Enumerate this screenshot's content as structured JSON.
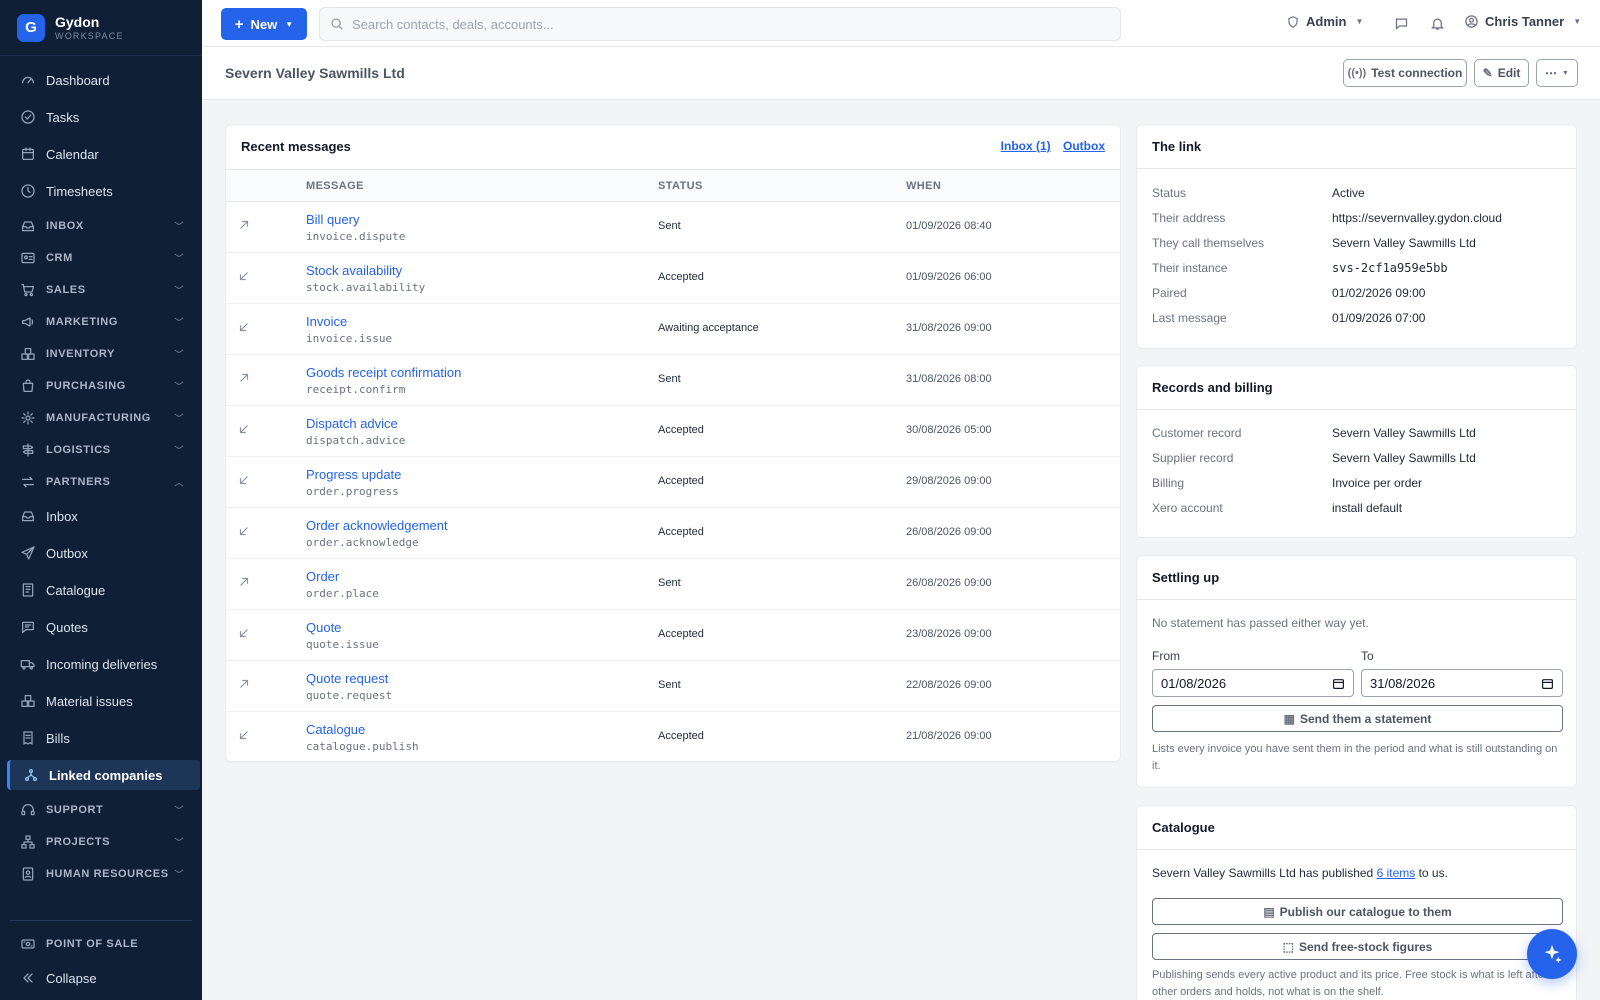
{
  "brand": {
    "logo_letter": "G",
    "name": "Gydon",
    "sub": "WORKSPACE"
  },
  "sidebar": {
    "items": [
      {
        "label": "Dashboard",
        "icon": "gauge-icon",
        "type": "item"
      },
      {
        "label": "Tasks",
        "icon": "check-circle-icon",
        "type": "item"
      },
      {
        "label": "Calendar",
        "icon": "calendar-icon",
        "type": "item"
      },
      {
        "label": "Timesheets",
        "icon": "clock-icon",
        "type": "item"
      },
      {
        "label": "INBOX",
        "icon": "inbox-icon",
        "type": "section"
      },
      {
        "label": "CRM",
        "icon": "contact-card-icon",
        "type": "section"
      },
      {
        "label": "SALES",
        "icon": "cart-icon",
        "type": "section"
      },
      {
        "label": "MARKETING",
        "icon": "megaphone-icon",
        "type": "section"
      },
      {
        "label": "INVENTORY",
        "icon": "boxes-icon",
        "type": "section"
      },
      {
        "label": "PURCHASING",
        "icon": "bag-icon",
        "type": "section"
      },
      {
        "label": "MANUFACTURING",
        "icon": "cog-icon",
        "type": "section"
      },
      {
        "label": "LOGISTICS",
        "icon": "signpost-icon",
        "type": "section"
      },
      {
        "label": "PARTNERS",
        "icon": "swap-icon",
        "type": "section-open"
      },
      {
        "label": "Inbox",
        "icon": "inbox-icon",
        "type": "item"
      },
      {
        "label": "Outbox",
        "icon": "send-icon",
        "type": "item"
      },
      {
        "label": "Catalogue",
        "icon": "book-icon",
        "type": "item"
      },
      {
        "label": "Quotes",
        "icon": "quote-icon",
        "type": "item"
      },
      {
        "label": "Incoming deliveries",
        "icon": "truck-icon",
        "type": "item"
      },
      {
        "label": "Material issues",
        "icon": "boxes-icon",
        "type": "item"
      },
      {
        "label": "Bills",
        "icon": "receipt-icon",
        "type": "item"
      },
      {
        "label": "Linked companies",
        "icon": "network-icon",
        "type": "active"
      },
      {
        "label": "SUPPORT",
        "icon": "headset-icon",
        "type": "section"
      },
      {
        "label": "PROJECTS",
        "icon": "sitemap-icon",
        "type": "section"
      },
      {
        "label": "HUMAN RESOURCES",
        "icon": "badge-icon",
        "type": "section"
      }
    ],
    "bottom": [
      {
        "label": "POINT OF SALE",
        "icon": "register-icon",
        "type": "section"
      },
      {
        "label": "Collapse",
        "icon": "chevrons-left-icon",
        "type": "item"
      }
    ]
  },
  "topbar": {
    "new_label": "New",
    "search_placeholder": "Search contacts, deals, accounts...",
    "admin_label": "Admin",
    "user_name": "Chris Tanner"
  },
  "page": {
    "title": "Severn Valley Sawmills Ltd",
    "test_connection_label": "Test connection",
    "edit_label": "Edit",
    "more_label": "⋯"
  },
  "messages": {
    "title": "Recent messages",
    "inbox_link": "Inbox (1)",
    "outbox_link": "Outbox",
    "columns": [
      "MESSAGE",
      "STATUS",
      "WHEN"
    ],
    "rows": [
      {
        "dir": "out",
        "name": "Bill query",
        "code": "invoice.dispute",
        "status": "Sent",
        "when": "01/09/2026 08:40"
      },
      {
        "dir": "in",
        "name": "Stock availability",
        "code": "stock.availability",
        "status": "Accepted",
        "when": "01/09/2026 06:00"
      },
      {
        "dir": "in",
        "name": "Invoice",
        "code": "invoice.issue",
        "status": "Awaiting acceptance",
        "when": "31/08/2026 09:00"
      },
      {
        "dir": "out",
        "name": "Goods receipt confirmation",
        "code": "receipt.confirm",
        "status": "Sent",
        "when": "31/08/2026 08:00"
      },
      {
        "dir": "in",
        "name": "Dispatch advice",
        "code": "dispatch.advice",
        "status": "Accepted",
        "when": "30/08/2026 05:00"
      },
      {
        "dir": "in",
        "name": "Progress update",
        "code": "order.progress",
        "status": "Accepted",
        "when": "29/08/2026 09:00"
      },
      {
        "dir": "in",
        "name": "Order acknowledgement",
        "code": "order.acknowledge",
        "status": "Accepted",
        "when": "26/08/2026 09:00"
      },
      {
        "dir": "out",
        "name": "Order",
        "code": "order.place",
        "status": "Sent",
        "when": "26/08/2026 09:00"
      },
      {
        "dir": "in",
        "name": "Quote",
        "code": "quote.issue",
        "status": "Accepted",
        "when": "23/08/2026 09:00"
      },
      {
        "dir": "out",
        "name": "Quote request",
        "code": "quote.request",
        "status": "Sent",
        "when": "22/08/2026 09:00"
      },
      {
        "dir": "in",
        "name": "Catalogue",
        "code": "catalogue.publish",
        "status": "Accepted",
        "when": "21/08/2026 09:00"
      }
    ]
  },
  "link": {
    "title": "The link",
    "fields": [
      {
        "k": "Status",
        "v": "Active",
        "mono": false
      },
      {
        "k": "Their address",
        "v": "https://severnvalley.gydon.cloud",
        "mono": false
      },
      {
        "k": "They call themselves",
        "v": "Severn Valley Sawmills Ltd",
        "mono": false
      },
      {
        "k": "Their instance",
        "v": "svs-2cf1a959e5bb",
        "mono": true
      },
      {
        "k": "Paired",
        "v": "01/02/2026 09:00",
        "mono": false
      },
      {
        "k": "Last message",
        "v": "01/09/2026 07:00",
        "mono": false
      }
    ]
  },
  "records": {
    "title": "Records and billing",
    "fields": [
      {
        "k": "Customer record",
        "v": "Severn Valley Sawmills Ltd"
      },
      {
        "k": "Supplier record",
        "v": "Severn Valley Sawmills Ltd"
      },
      {
        "k": "Billing",
        "v": "Invoice per order"
      },
      {
        "k": "Xero account",
        "v": "install default"
      }
    ]
  },
  "settling": {
    "title": "Settling up",
    "note": "No statement has passed either way yet.",
    "from_label": "From",
    "to_label": "To",
    "from_value": "01/08/2026",
    "to_value": "31/08/2026",
    "send_label": "Send them a statement",
    "help": "Lists every invoice you have sent them in the period and what is still outstanding on it."
  },
  "catalogue": {
    "title": "Catalogue",
    "text_before": "Severn Valley Sawmills Ltd has published ",
    "items_link": "6 items",
    "text_after": " to us.",
    "publish_label": "Publish our catalogue to them",
    "freestock_label": "Send free-stock figures",
    "help": "Publishing sends every active product and its price. Free stock is what is left after other orders and holds, not what is on the shelf."
  },
  "colors": {
    "sidebar_bg": "#0f1f36",
    "accent": "#2563eb",
    "active_item": "#1d3557"
  }
}
